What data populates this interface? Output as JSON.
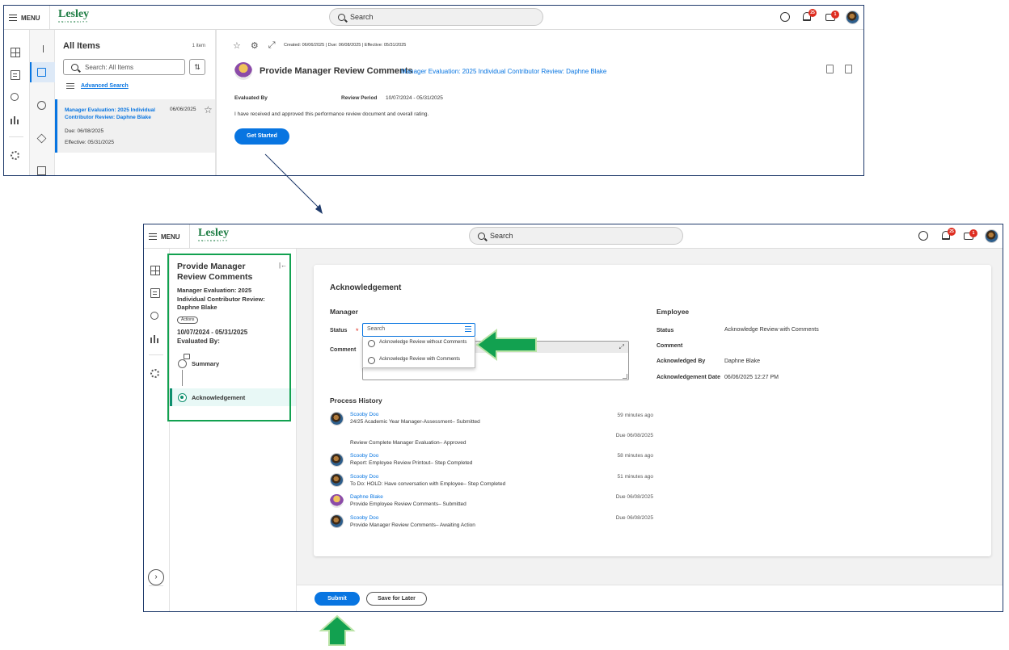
{
  "colors": {
    "brand_green": "#1e7d44",
    "primary_blue": "#0875e1",
    "highlight_green": "#12a150",
    "badge_red": "#de2e21"
  },
  "shell": {
    "menu_label": "MENU",
    "logo_text": "Lesley",
    "logo_sub": "UNIVERSITY",
    "search_placeholder": "Search",
    "notifications_count": "25",
    "inbox_count": "1"
  },
  "window1": {
    "items_title": "All Items",
    "items_count": "1 item",
    "items_search_placeholder": "Search: All Items",
    "advanced_search": "Advanced Search",
    "item": {
      "title": "Manager Evaluation: 2025 Individual Contributor Review: Daphne Blake",
      "date": "06/06/2025",
      "due": "Due: 06/08/2025",
      "effective": "Effective: 05/31/2025"
    },
    "meta": "Created: 06/06/2025 | Due: 06/08/2025 | Effective: 05/31/2025",
    "task_title": "Provide Manager Review Comments",
    "task_link": "Manager Evaluation: 2025 Individual Contributor Review: Daphne Blake",
    "evaluated_by_label": "Evaluated By",
    "review_period_label": "Review Period",
    "review_period_value": "10/07/2024 - 05/31/2025",
    "statement": "I have received and approved this performance review document and overall rating.",
    "get_started": "Get Started"
  },
  "window2": {
    "side": {
      "title": "Provide Manager Review Comments",
      "subtitle": "Manager Evaluation: 2025 Individual Contributor Review: Daphne Blake",
      "actions": "Actions",
      "date_range": "10/07/2024 - 05/31/2025",
      "evaluated_by": "Evaluated By:",
      "steps": [
        "Summary",
        "Acknowledgement"
      ]
    },
    "section_title": "Acknowledgement",
    "manager": {
      "heading": "Manager",
      "status_label": "Status",
      "status_placeholder": "Search",
      "comment_label": "Comment",
      "options": [
        "Acknowledge Review without Comments",
        "Acknowledge Review with Comments"
      ]
    },
    "employee": {
      "heading": "Employee",
      "status_label": "Status",
      "status_value": "Acknowledge Review with Comments",
      "comment_label": "Comment",
      "ack_by_label": "Acknowledged By",
      "ack_by_value": "Daphne Blake",
      "ack_date_label": "Acknowledgement Date",
      "ack_date_value": "06/06/2025 12:27 PM"
    },
    "process_history": {
      "heading": "Process History",
      "rows": [
        {
          "name": "Scooby Doo",
          "desc": "24/25 Academic Year Manager-Assessment– Submitted",
          "time": "59 minutes ago"
        },
        {
          "name": "",
          "desc": "Review Complete Manager Evaluation– Approved",
          "time": "Due 06/08/2025"
        },
        {
          "name": "Scooby Doo",
          "desc": "Report: Employee Review Printout– Step Completed",
          "time": "58 minutes ago"
        },
        {
          "name": "Scooby Doo",
          "desc": "To Do: HOLD: Have conversation with Employee– Step Completed",
          "time": "51 minutes ago"
        },
        {
          "name": "Daphne Blake",
          "desc": "Provide Employee Review Comments– Submitted",
          "time": "Due 06/08/2025"
        },
        {
          "name": "Scooby Doo",
          "desc": "Provide Manager Review Comments– Awaiting Action",
          "time": "Due 06/08/2025"
        }
      ]
    },
    "submit": "Submit",
    "save_for_later": "Save for Later"
  }
}
